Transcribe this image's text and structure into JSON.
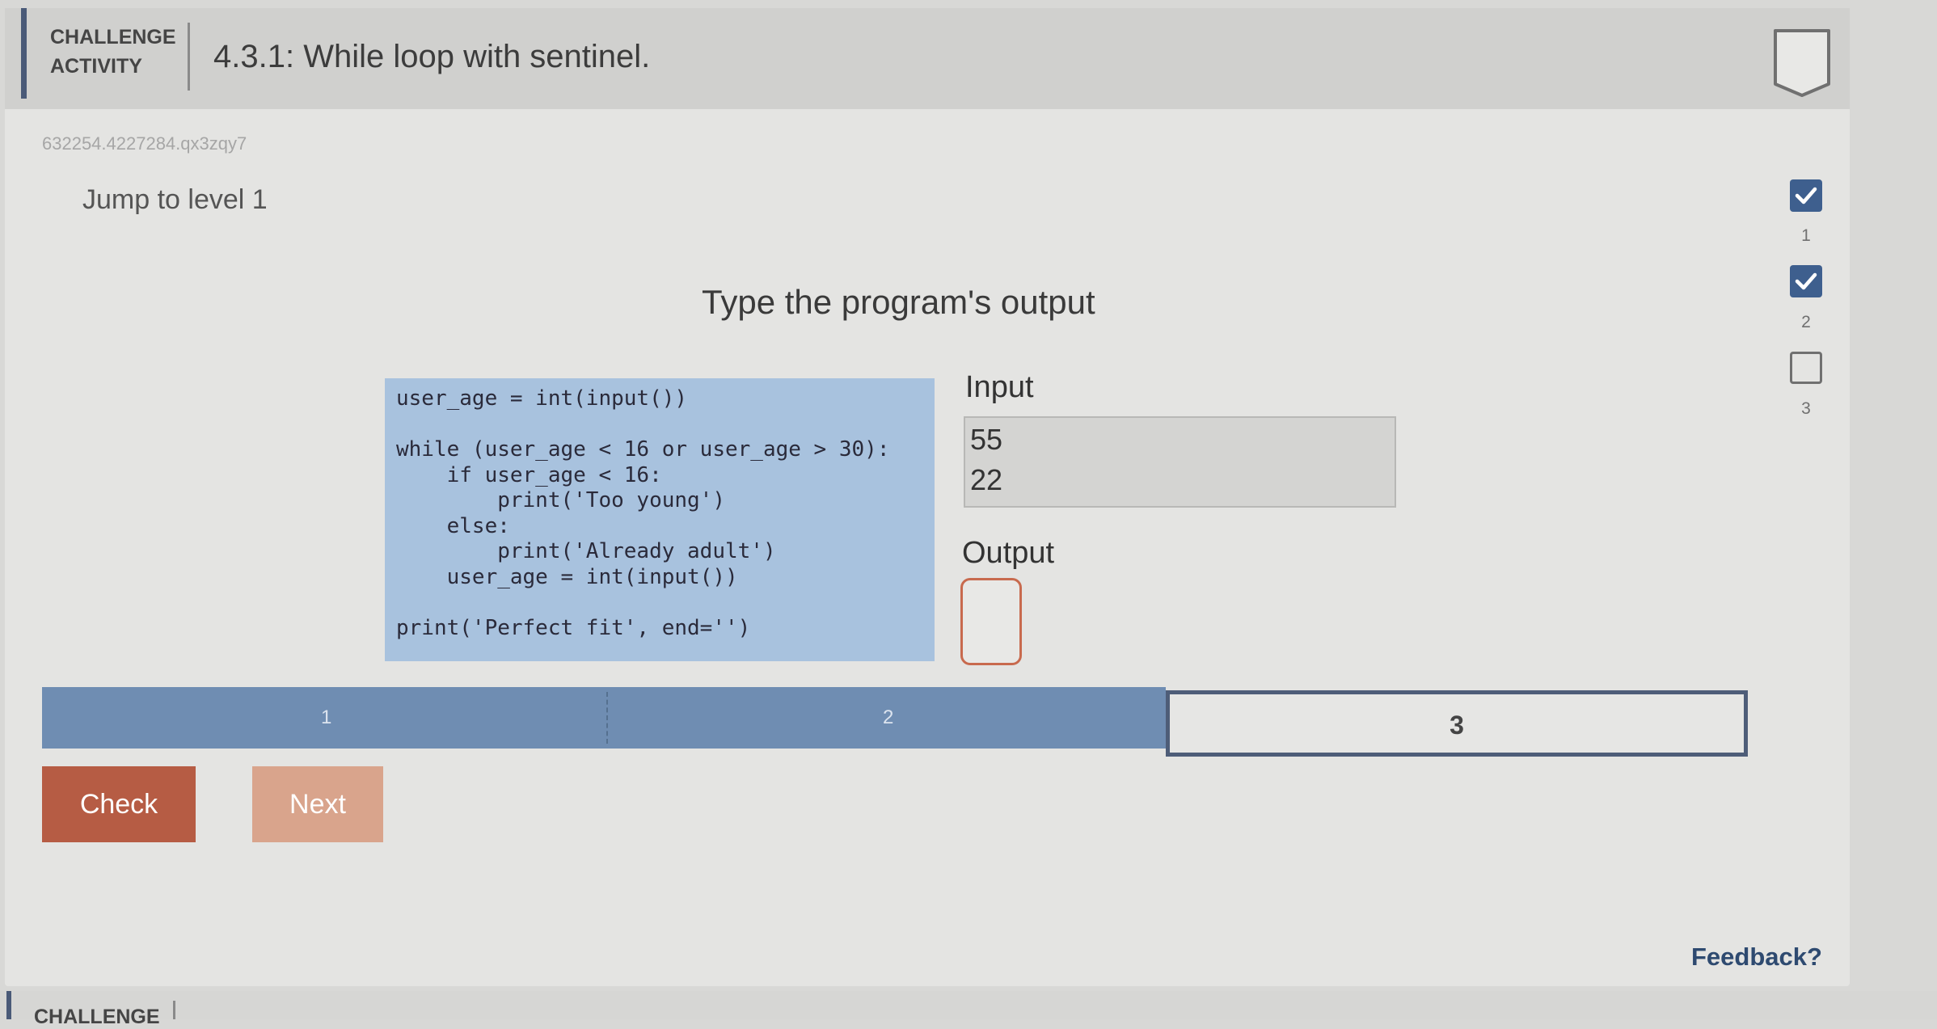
{
  "header": {
    "label_line1": "CHALLENGE",
    "label_line2": "ACTIVITY",
    "title": "4.3.1: While loop with sentinel."
  },
  "activity_id": "632254.4227284.qx3zqy7",
  "jump_link": "Jump to level 1",
  "levels": [
    {
      "number": "1",
      "completed": true
    },
    {
      "number": "2",
      "completed": true
    },
    {
      "number": "3",
      "completed": false
    }
  ],
  "instruction": "Type the program's output",
  "code": "user_age = int(input())\n\nwhile (user_age < 16 or user_age > 30):\n    if user_age < 16:\n        print('Too young')\n    else:\n        print('Already adult')\n    user_age = int(input())\n\nprint('Perfect fit', end='')",
  "input": {
    "label": "Input",
    "lines": [
      "55",
      "22"
    ]
  },
  "output": {
    "label": "Output",
    "value": ""
  },
  "progress": {
    "segments": [
      "1",
      "2",
      "3"
    ],
    "completed": 2,
    "current": "3"
  },
  "buttons": {
    "check": "Check",
    "next": "Next"
  },
  "feedback": "Feedback?",
  "next_section_label": "CHALLENGE",
  "colors": {
    "accent": "#4a5a78",
    "check_button": "#b65c44",
    "next_button": "#d9a48c",
    "code_bg": "#a8c2de",
    "progress_done": "#6f8db2",
    "level_done": "#3e5f8e",
    "feedback": "#2e4a70"
  }
}
